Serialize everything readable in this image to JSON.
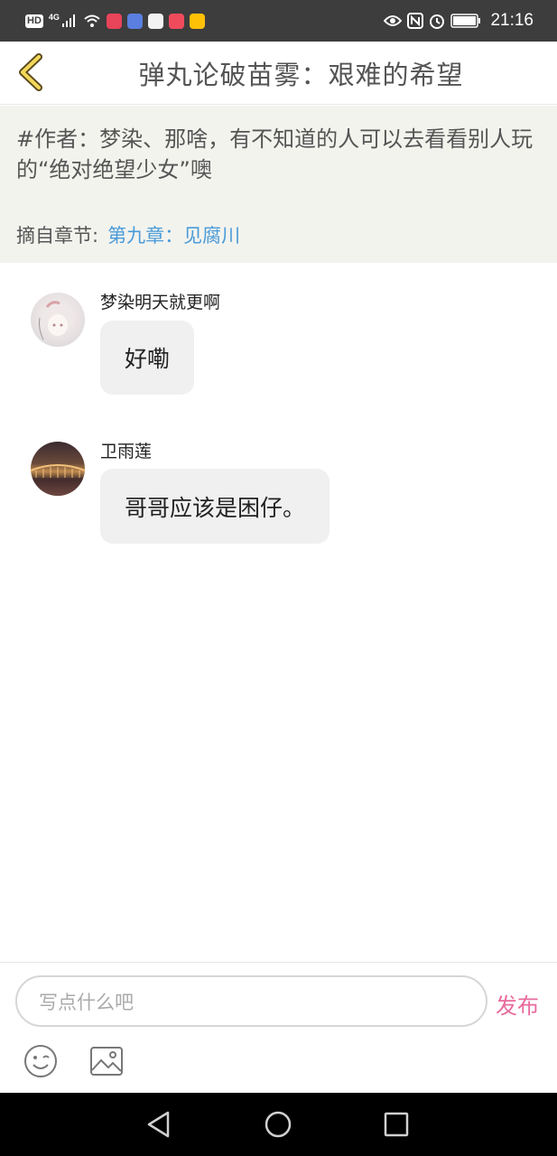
{
  "status_bar": {
    "hd": "HD",
    "network": "4G",
    "time": "21:16",
    "icons": [
      "signal-icon",
      "wifi-icon",
      "app-red-icon",
      "music-icon",
      "hand-icon",
      "app-pink-icon",
      "app-yellow-icon",
      "eye-icon",
      "nfc-icon",
      "alarm-icon",
      "battery-icon"
    ]
  },
  "header": {
    "title": "弹丸论破苗雾：艰难的希望",
    "back_icon": "chevron-left-icon"
  },
  "excerpt": {
    "text": "#作者：梦染、那啥，有不知道的人可以去看看别人玩的“绝对绝望少女”噢",
    "source_label": "摘自章节:",
    "source_link": "第九章：见腐川"
  },
  "comments": [
    {
      "user": "梦染明天就更啊",
      "text": "好嘞"
    },
    {
      "user": "卫雨莲",
      "text": "哥哥应该是困仔。"
    }
  ],
  "input": {
    "placeholder": "写点什么吧",
    "publish_label": "发布"
  },
  "colors": {
    "accent_link": "#4a9bd8",
    "publish": "#e86a9c",
    "excerpt_bg": "#f3f3ee",
    "bubble_bg": "#f0f0f0"
  }
}
